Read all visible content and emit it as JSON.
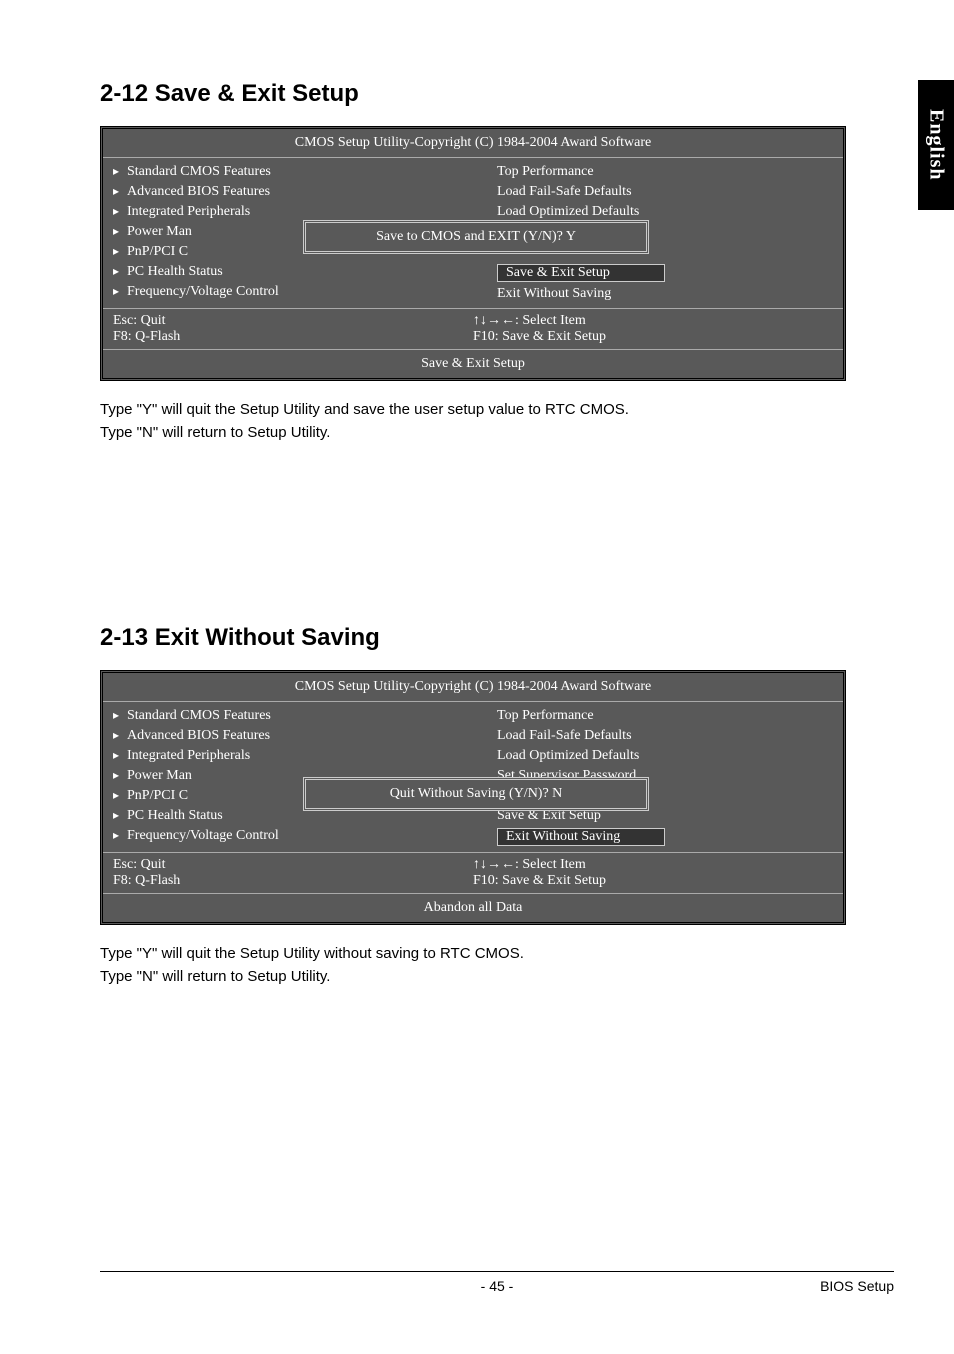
{
  "side_tab": "English",
  "section1": {
    "title": "2-12  Save & Exit Setup",
    "bios_title": "CMOS Setup Utility-Copyright (C) 1984-2004 Award Software",
    "left_menu": [
      "Standard CMOS Features",
      "Advanced BIOS Features",
      "Integrated Peripherals",
      "Power Man",
      "PnP/PCI C",
      "PC Health Status",
      "Frequency/Voltage Control"
    ],
    "right_menu": [
      "Top Performance",
      "Load Fail-Safe Defaults",
      "Load Optimized Defaults",
      "",
      "",
      "Save & Exit Setup",
      "Exit Without Saving"
    ],
    "highlight_index_right": 5,
    "dialog": "Save to CMOS and EXIT (Y/N)? Y",
    "keys_left": [
      "Esc: Quit",
      "F8: Q-Flash"
    ],
    "keys_right": [
      "↑↓→←: Select Item",
      "F10: Save & Exit Setup"
    ],
    "footer": "Save & Exit Setup",
    "body": [
      "Type \"Y\" will quit the Setup Utility and save the user setup value to RTC CMOS.",
      "Type \"N\" will return to Setup Utility."
    ]
  },
  "section2": {
    "title": "2-13  Exit Without Saving",
    "bios_title": "CMOS Setup Utility-Copyright (C) 1984-2004 Award Software",
    "left_menu": [
      "Standard CMOS Features",
      "Advanced BIOS Features",
      "Integrated Peripherals",
      "Power Man",
      "PnP/PCI C",
      "PC Health Status",
      "Frequency/Voltage Control"
    ],
    "right_menu": [
      "Top Performance",
      "Load Fail-Safe Defaults",
      "Load Optimized Defaults",
      "Set Supervisor Password",
      "",
      "Save & Exit Setup",
      "Exit Without Saving"
    ],
    "highlight_index_right": 6,
    "dialog": "Quit Without Saving (Y/N)? N",
    "keys_left": [
      "Esc: Quit",
      "F8: Q-Flash"
    ],
    "keys_right": [
      "↑↓→←: Select Item",
      "F10: Save & Exit Setup"
    ],
    "footer": "Abandon all Data",
    "body": [
      "Type \"Y\" will quit the Setup Utility without saving to RTC CMOS.",
      "Type \"N\" will return to Setup Utility."
    ]
  },
  "page_footer": {
    "page_number": "- 45 -",
    "section_name": "BIOS Setup"
  }
}
